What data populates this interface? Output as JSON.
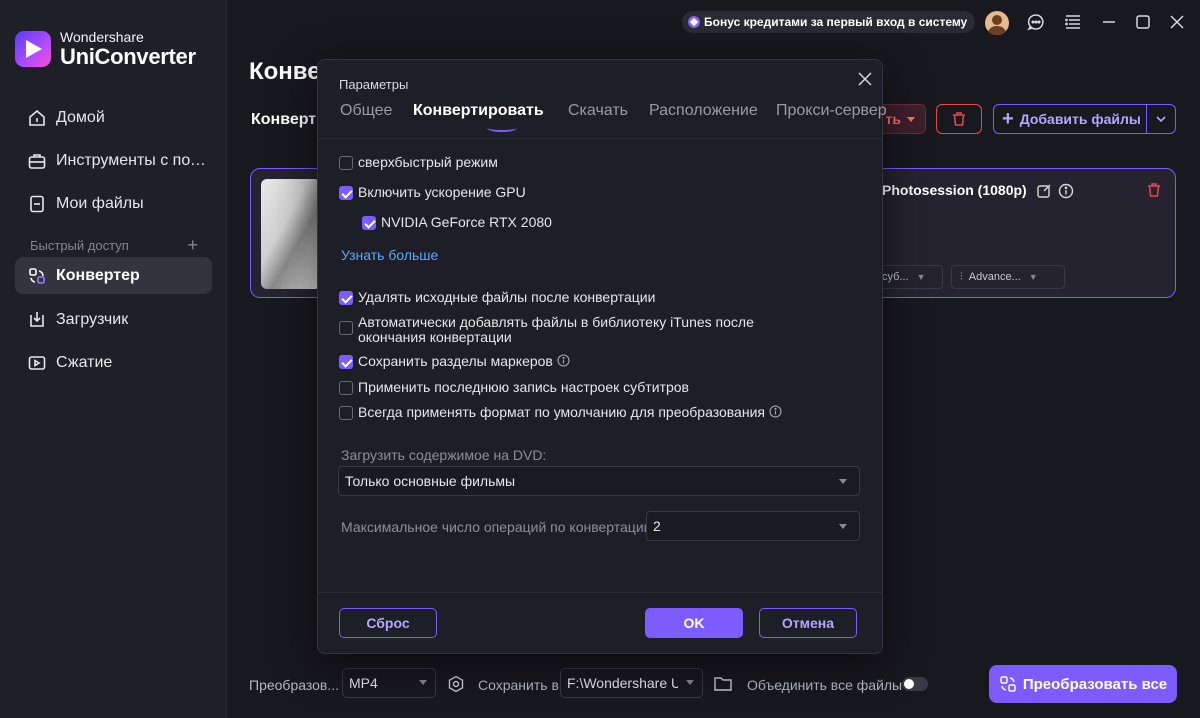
{
  "app": {
    "brand_sub": "Wondershare",
    "brand_main": "UniConverter",
    "accent_color": "#7c5cff"
  },
  "topbar": {
    "bonus_text": "Бонус кредитами за первый вход в систему",
    "icons": [
      "avatar",
      "chat-icon",
      "menu-icon",
      "minimize-icon",
      "maximize-icon",
      "close-icon"
    ]
  },
  "sidebar": {
    "items": [
      {
        "label": "Домой",
        "icon": "home-icon"
      },
      {
        "label": "Инструменты с под...",
        "icon": "toolbox-icon"
      },
      {
        "label": "Мои файлы",
        "icon": "files-icon"
      }
    ],
    "quick_access_label": "Быстрый доступ",
    "quick_items": [
      {
        "label": "Конвертер",
        "icon": "converter-icon",
        "active": true
      },
      {
        "label": "Загрузчик",
        "icon": "download-icon"
      },
      {
        "label": "Сжатие",
        "icon": "compress-icon"
      }
    ]
  },
  "main": {
    "title": "Конве",
    "tab_label": "Конверт",
    "convert_format_fragment": "ть",
    "add_files_label": "Добавить файлы",
    "file": {
      "name": "Photosession (1080p)",
      "subtitle_chip": "суб...",
      "audio_chip": "Advance..."
    }
  },
  "bottom": {
    "output_label": "Преобразов...",
    "format_value": "MP4",
    "save_to_label": "Сохранить в",
    "save_path": "F:\\Wondershare Ur",
    "merge_label": "Объединить все файлы",
    "convert_all_label": "Преобразовать все"
  },
  "dialog": {
    "title": "Параметры",
    "tabs": [
      {
        "label": "Общее",
        "active": false
      },
      {
        "label": "Конвертировать",
        "active": true
      },
      {
        "label": "Скачать",
        "active": false
      },
      {
        "label": "Расположение",
        "active": false
      },
      {
        "label": "Прокси-сервер",
        "active": false
      }
    ],
    "options": {
      "superfast": {
        "label": "сверхбыстрый режим",
        "checked": false
      },
      "gpu": {
        "label": "Включить ускорение GPU",
        "checked": true
      },
      "gpu_device": {
        "label": "NVIDIA GeForce RTX 2080",
        "checked": true
      },
      "learn_more": "Узнать больше",
      "delete_source": {
        "label": "Удалять исходные файлы после конвертации",
        "checked": true
      },
      "itunes": {
        "label": "Автоматически добавлять файлы в библиотеку iTunes после окончания конвертации",
        "checked": false
      },
      "markers": {
        "label": "Сохранить разделы маркеров",
        "checked": true
      },
      "subtitles": {
        "label": "Применить последнюю запись настроек субтитров",
        "checked": false
      },
      "default_format": {
        "label": "Всегда применять формат по умолчанию для преобразования",
        "checked": false
      }
    },
    "dvd": {
      "label": "Загрузить содержимое на DVD:",
      "value": "Только основные фильмы"
    },
    "max_ops": {
      "label": "Максимальное число операций по конвертации:",
      "value": "2"
    },
    "buttons": {
      "reset": "Сброс",
      "ok": "OK",
      "cancel": "Отмена"
    }
  }
}
